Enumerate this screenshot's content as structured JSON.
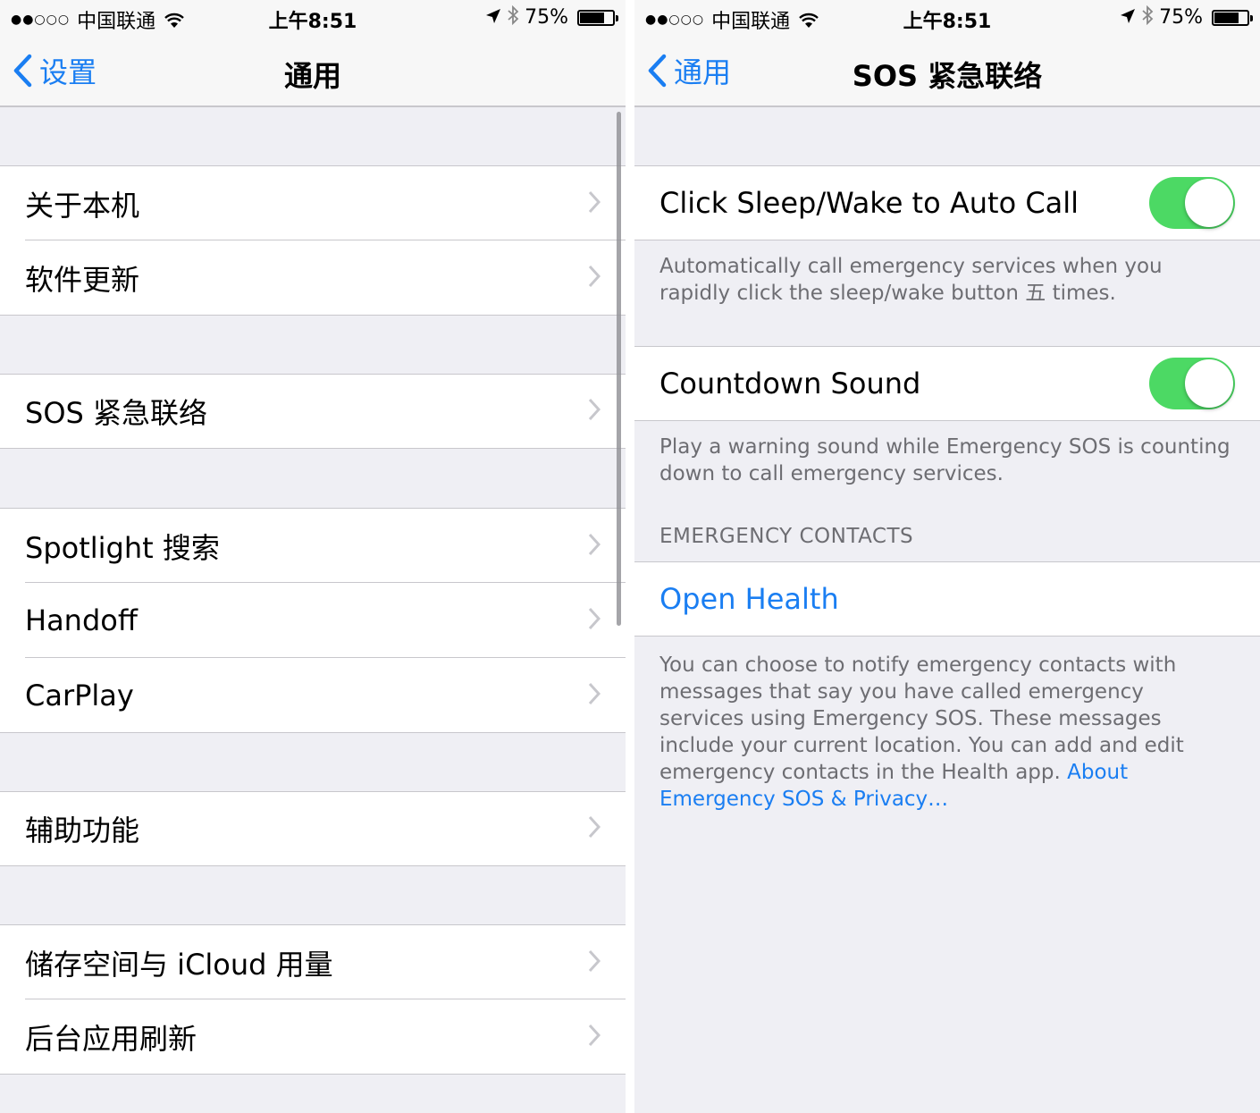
{
  "status_bar": {
    "signal": "●●○○○",
    "carrier": "中国联通",
    "time": "上午8:51",
    "battery": "75%",
    "battery_level": 0.75
  },
  "left_screen": {
    "back_label": "设置",
    "title": "通用",
    "items": [
      {
        "label": "关于本机"
      },
      {
        "label": "软件更新"
      },
      {
        "label": "SOS 紧急联络"
      },
      {
        "label": "Spotlight 搜索"
      },
      {
        "label": "Handoff"
      },
      {
        "label": "CarPlay"
      },
      {
        "label": "辅助功能"
      },
      {
        "label": "储存空间与 iCloud 用量"
      },
      {
        "label": "后台应用刷新"
      }
    ]
  },
  "right_screen": {
    "back_label": "通用",
    "title": "SOS 紧急联络",
    "auto_call": {
      "label": "Click Sleep/Wake to Auto Call",
      "on": true,
      "footer": "Automatically call emergency services when you rapidly click the sleep/wake button 五 times."
    },
    "countdown": {
      "label": "Countdown Sound",
      "on": true,
      "footer": "Play a warning sound while Emergency SOS is counting down to call emergency services."
    },
    "contacts_header": "EMERGENCY CONTACTS",
    "open_health": "Open Health",
    "contacts_footer": "You can choose to notify emergency contacts with messages that say you have called emergency services using Emergency SOS. These messages include your current location. You can add and edit emergency contacts in the Health app.",
    "privacy_link": "About Emergency SOS & Privacy…"
  },
  "colors": {
    "accent": "#1a7ef2",
    "toggle_on": "#4cd964",
    "background": "#efeff4"
  }
}
